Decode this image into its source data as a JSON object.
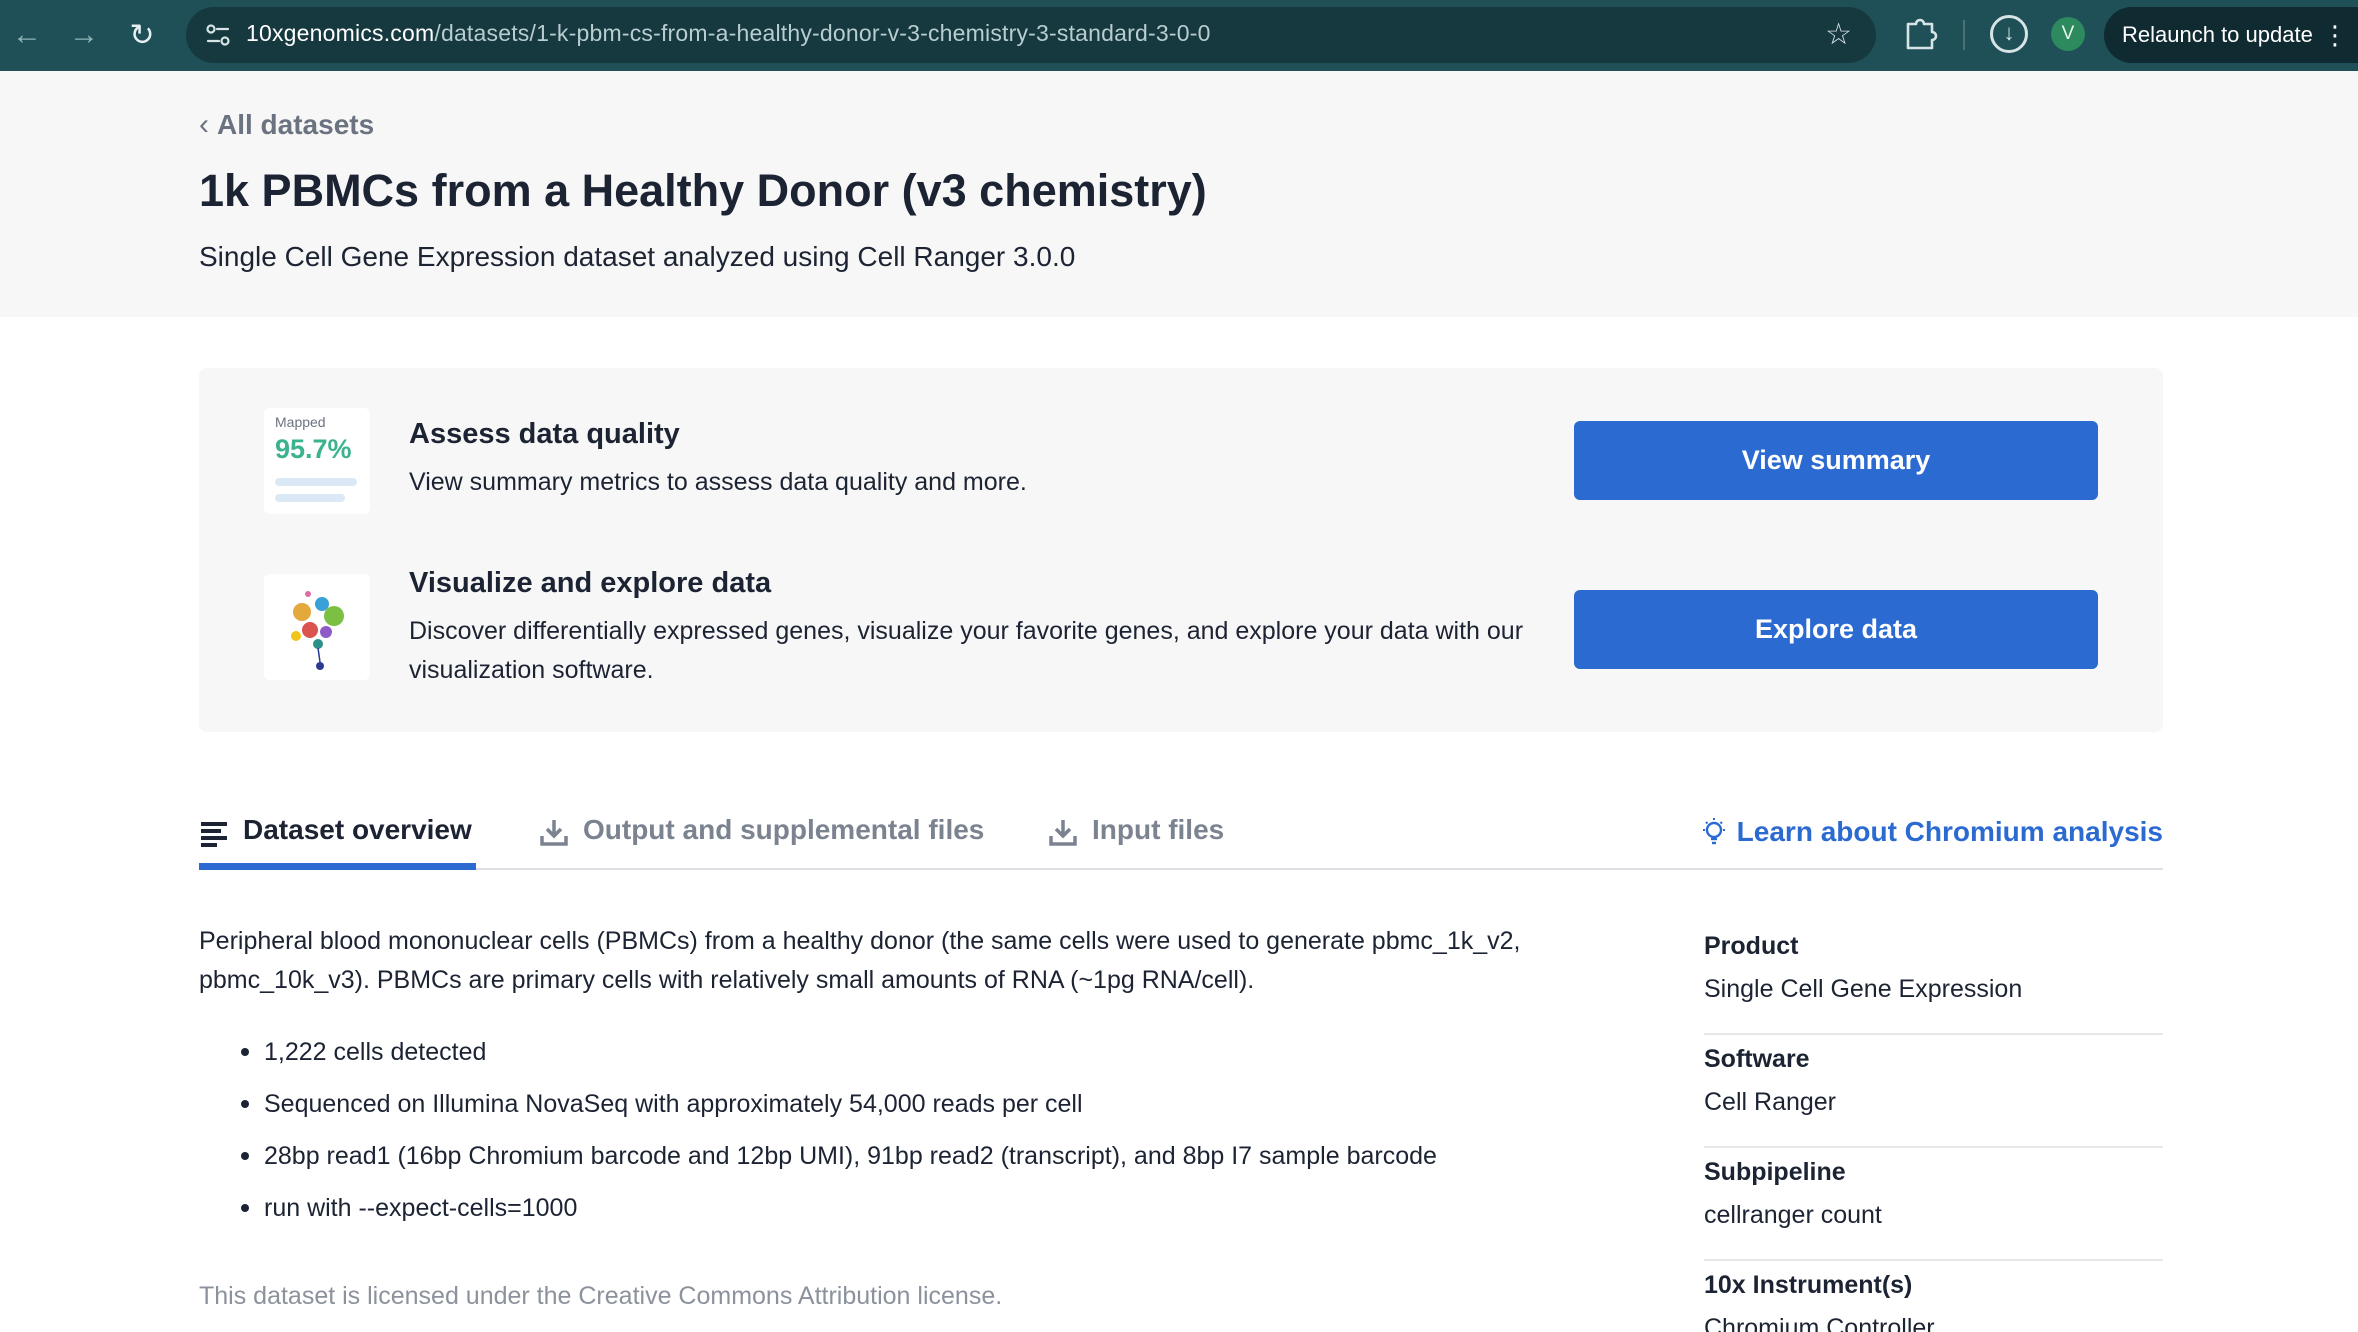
{
  "browser": {
    "url_host": "10xgenomics.com",
    "url_path": "/datasets/1-k-pbm-cs-from-a-healthy-donor-v-3-chemistry-3-standard-3-0-0",
    "profile_initial": "V",
    "relaunch_label": "Relaunch to update",
    "back_icon": "arrow-left-icon",
    "forward_icon": "arrow-right-icon",
    "reload_icon": "reload-icon"
  },
  "header": {
    "back_label": "All datasets",
    "title": "1k PBMCs from a Healthy Donor (v3 chemistry)",
    "subtitle": "Single Cell Gene Expression dataset analyzed using Cell Ranger 3.0.0"
  },
  "actions": {
    "quality": {
      "thumb_label": "Mapped",
      "thumb_value": "95.7%",
      "heading": "Assess data quality",
      "text": "View summary metrics to assess data quality and more.",
      "button": "View summary"
    },
    "explore": {
      "heading": "Visualize and explore data",
      "text": "Discover differentially expressed genes, visualize your favorite genes, and explore your data with our visualization software.",
      "button": "Explore data"
    }
  },
  "tabs": [
    {
      "label": "Dataset overview",
      "icon": "list-icon",
      "active": true
    },
    {
      "label": "Output and supplemental files",
      "icon": "download-icon",
      "active": false
    },
    {
      "label": "Input files",
      "icon": "download-icon",
      "active": false
    }
  ],
  "learn_link": "Learn about Chromium analysis",
  "overview": {
    "description": "Peripheral blood mononuclear cells (PBMCs) from a healthy donor (the same cells were used to generate pbmc_1k_v2, pbmc_10k_v3). PBMCs are primary cells with relatively small amounts of RNA (~1pg RNA/cell).",
    "bullets": [
      "1,222 cells detected",
      "Sequenced on Illumina NovaSeq with approximately 54,000 reads per cell",
      "28bp read1 (16bp Chromium barcode and 12bp UMI), 91bp read2 (transcript), and 8bp I7 sample barcode",
      "run with --expect-cells=1000"
    ],
    "license": "This dataset is licensed under the Creative Commons Attribution license."
  },
  "metadata": [
    {
      "label": "Product",
      "value": "Single Cell Gene Expression"
    },
    {
      "label": "Software",
      "value": "Cell Ranger"
    },
    {
      "label": "Subpipeline",
      "value": "cellranger count"
    },
    {
      "label": "10x Instrument(s)",
      "value": "Chromium Controller"
    }
  ],
  "colors": {
    "accent": "#2b6ad1",
    "chrome": "#1f4f57",
    "quality_value": "#3cb38e"
  }
}
